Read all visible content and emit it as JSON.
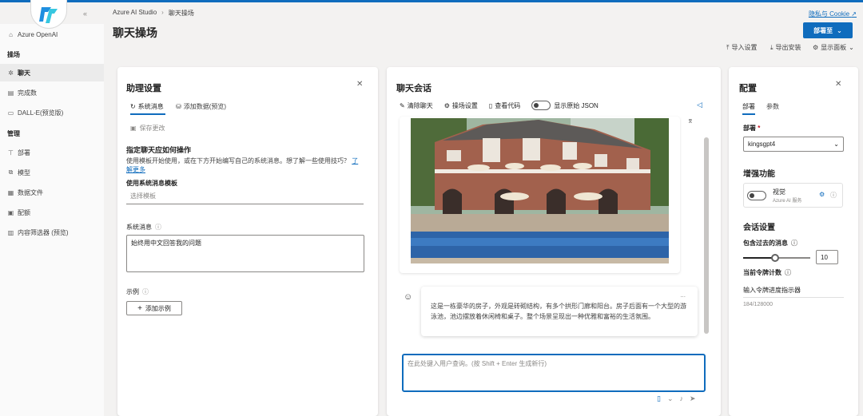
{
  "app": {
    "name": "Azure AI Studio",
    "cookie_link": "隐私与 Cookie"
  },
  "sidebar": {
    "azure_openai": "Azure OpenAI",
    "section_playground": "操场",
    "section_manage": "管理",
    "items": [
      {
        "label": "聊天",
        "icon": "chat-icon"
      },
      {
        "label": "完成数",
        "icon": "completions-icon"
      },
      {
        "label": "DALL-E(预览版)",
        "icon": "image-icon"
      },
      {
        "label": "部署",
        "icon": "deployments-icon"
      },
      {
        "label": "模型",
        "icon": "models-icon"
      },
      {
        "label": "数据文件",
        "icon": "data-files-icon"
      },
      {
        "label": "配额",
        "icon": "quota-icon"
      },
      {
        "label": "内容筛选器 (预览)",
        "icon": "filter-icon"
      }
    ]
  },
  "header": {
    "breadcrumb": [
      "Azure AI Studio",
      "聊天操场"
    ],
    "title": "聊天操场",
    "deploy_button": "部署至",
    "import_settings": "导入设置",
    "export_settings": "导出安装",
    "show_panels": "显示面板"
  },
  "assistant": {
    "title": "助理设置",
    "tabs": [
      "系统消息",
      "添加数据(预览)"
    ],
    "save_changes": "保存更改",
    "instructions_title": "指定聊天应如何操作",
    "instructions_text": "使用模板开始使用，或在下方开始编写自己的系统消息。想了解一些使用技巧？",
    "learn_more": "了解更多",
    "template_label": "使用系统消息模板",
    "template_placeholder": "选择模板",
    "system_message_label": "系统消息",
    "system_message_value": "始终用中文回答我的问题",
    "examples_label": "示例",
    "add_example": "添加示例"
  },
  "chat": {
    "title": "聊天会话",
    "clear_chat": "清除聊天",
    "playground_settings": "操场设置",
    "view_code": "查看代码",
    "show_raw_json": "显示原始 JSON",
    "response_text": "这是一栋豪华的房子，外观是砖砌结构，有多个拱形门廊和阳台。房子后面有一个大型的游泳池，池边摆放着休闲椅和桌子。整个场景呈现出一种优雅和富裕的生活氛围。",
    "more_options": "...",
    "input_placeholder": "在此处键入用户查询。(按 Shift + Enter 生成新行)"
  },
  "config": {
    "title": "配置",
    "tabs": [
      "部署",
      "参数"
    ],
    "deployment_label": "部署",
    "required_mark": "*",
    "deployment_value": "kingsgpt4",
    "enhancements_title": "增强功能",
    "vision_label": "视觉",
    "vision_sub": "Azure AI 服务",
    "session_title": "会话设置",
    "past_messages_label": "包含过去的消息",
    "past_messages_value": "10",
    "token_count_label": "当前令牌计数",
    "token_progress_text": "输入令牌进度指示器",
    "token_count_value": "184/128000"
  },
  "colors": {
    "accent": "#0f6cbd",
    "text": "#242424",
    "muted": "#8a8886"
  }
}
